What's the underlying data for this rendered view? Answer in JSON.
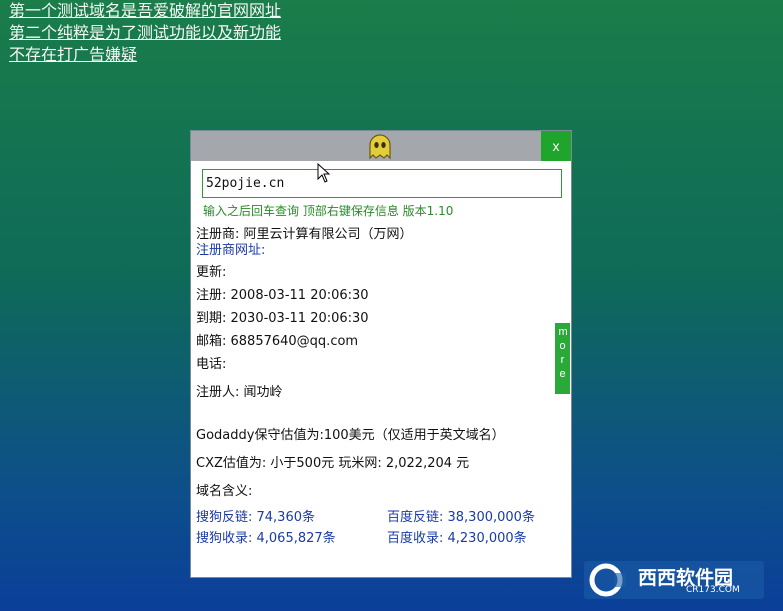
{
  "top_links": [
    "第一个测试域名是吾爱破解的官网网址",
    "第二个纯粹是为了测试功能以及新功能",
    "不存在打广告嫌疑"
  ],
  "dialog": {
    "close_label": "x",
    "input_value": "52pojie.cn",
    "hint": "输入之后回车查询  顶部右键保存信息  版本1.10",
    "registrar": "注册商: 阿里云计算有限公司（万网）",
    "registrar_url_label": "注册商网址:",
    "updated": "更新:",
    "registered": "注册: 2008-03-11 20:06:30",
    "expires": "到期: 2030-03-11 20:06:30",
    "email": "邮箱: 68857640@qq.com",
    "phone": "电话:",
    "registrant": "注册人: 闻功岭",
    "godaddy": "Godaddy保守估值为:100美元（仅适用于英文域名）",
    "cxz": "CXZ估值为: 小于500元    玩米网:  2,022,204 元",
    "meaning": "域名含义:",
    "sogou_links": "搜狗反链: 74,360条",
    "baidu_links": "百度反链: 38,300,000条",
    "sogou_index": "搜狗收录: 4,065,827条",
    "baidu_index": "百度收录: 4,230,000条",
    "more_label": "more"
  },
  "watermark_text": "西西软件园",
  "watermark_sub": "CR173.COM"
}
